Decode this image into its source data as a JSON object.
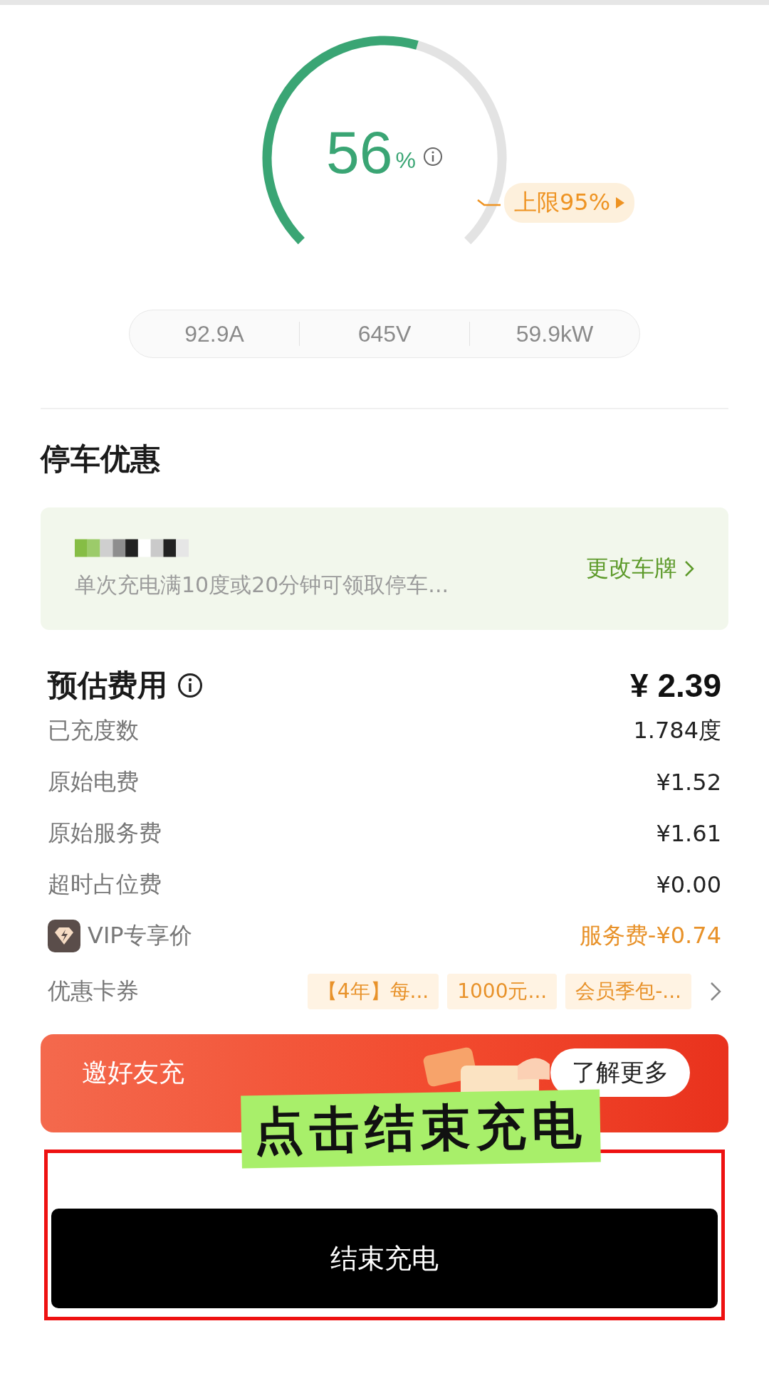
{
  "gauge": {
    "value": "56",
    "unit": "%",
    "limit_label": "上限95%"
  },
  "stats": [
    "92.9A",
    "645V",
    "59.9kW"
  ],
  "parking": {
    "title": "停车优惠",
    "note": "单次充电满10度或20分钟可领取停车...",
    "action": "更改车牌"
  },
  "fees": {
    "title": "预估费用",
    "total": "¥ 2.39",
    "rows": [
      {
        "kind": "plain",
        "label": "已充度数",
        "value": "1.784度"
      },
      {
        "kind": "plain",
        "label": "原始电费",
        "value": "¥1.52"
      },
      {
        "kind": "plain",
        "label": "原始服务费",
        "value": "¥1.61"
      },
      {
        "kind": "plain",
        "label": "超时占位费",
        "value": "¥0.00"
      },
      {
        "kind": "vip",
        "label": "VIP专享价",
        "value": "服务费-¥0.74"
      }
    ],
    "coupons": {
      "label": "优惠卡券",
      "chips": [
        "【4年】每...",
        "1000元...",
        "会员季包-..."
      ]
    }
  },
  "banner": {
    "text": "邀好友充",
    "button": "了解更多"
  },
  "overlay": {
    "sticker": "点击结束充电"
  },
  "end_button": "结束充电"
}
